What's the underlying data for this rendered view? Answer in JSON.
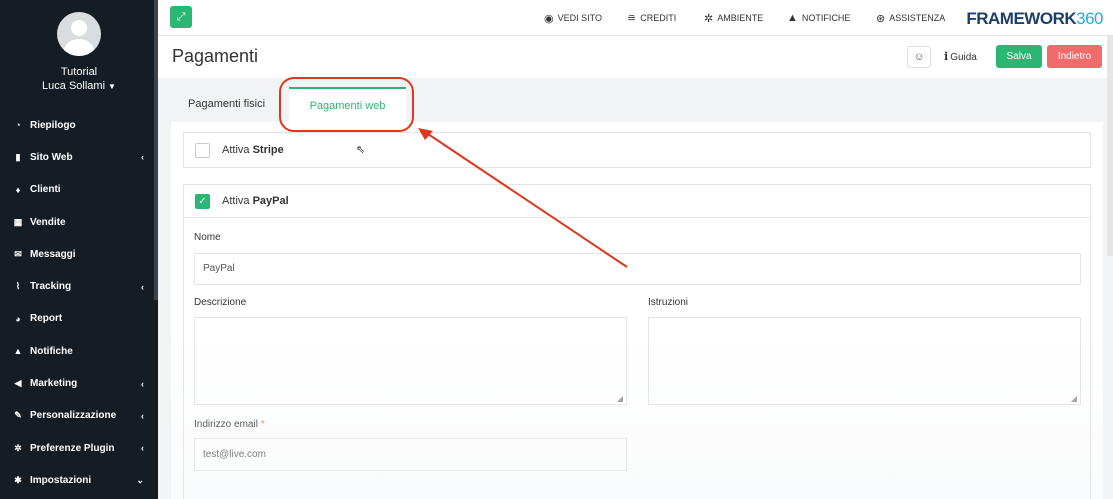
{
  "sidebar": {
    "user_line1": "Tutorial",
    "user_line2": "Luca Sollami",
    "items": [
      {
        "label": "Riepilogo",
        "icon": "dashboard-icon",
        "glyph": "◔",
        "chevron": ""
      },
      {
        "label": "Sito Web",
        "icon": "file-icon",
        "glyph": "▮",
        "chevron": "‹"
      },
      {
        "label": "Clienti",
        "icon": "person-icon",
        "glyph": "♦",
        "chevron": ""
      },
      {
        "label": "Vendite",
        "icon": "calculator-icon",
        "glyph": "▦",
        "chevron": ""
      },
      {
        "label": "Messaggi",
        "icon": "envelope-icon",
        "glyph": "✉",
        "chevron": ""
      },
      {
        "label": "Tracking",
        "icon": "chart-icon",
        "glyph": "⌇",
        "chevron": "‹"
      },
      {
        "label": "Report",
        "icon": "pie-icon",
        "glyph": "◕",
        "chevron": ""
      },
      {
        "label": "Notifiche",
        "icon": "bell-icon",
        "glyph": "▲",
        "chevron": ""
      },
      {
        "label": "Marketing",
        "icon": "megaphone-icon",
        "glyph": "◀",
        "chevron": "‹"
      },
      {
        "label": "Personalizzazione",
        "icon": "brush-icon",
        "glyph": "✎",
        "chevron": "‹"
      },
      {
        "label": "Preferenze Plugin",
        "icon": "cogs-icon",
        "glyph": "✲",
        "chevron": "‹"
      },
      {
        "label": "Impostazioni",
        "icon": "gear-icon",
        "glyph": "✱",
        "chevron": "⌄"
      }
    ]
  },
  "topbar": {
    "vedi_sito": "VEDI SITO",
    "crediti": "CREDITI",
    "ambiente": "AMBIENTE",
    "notifiche": "NOTIFICHE",
    "assistenza": "ASSISTENZA",
    "brand_text": "FRAMEWORK",
    "brand_num": "360"
  },
  "header": {
    "title": "Pagamenti",
    "smile": "☺",
    "guida_i": "i",
    "guida": "Guida",
    "salva": "Salva",
    "indietro": "Indietro"
  },
  "tabs": {
    "fisici": "Pagamenti fisici",
    "web": "Pagamenti web"
  },
  "stripe": {
    "prefix": "Attiva ",
    "name": "Stripe",
    "checked": false
  },
  "paypal": {
    "prefix": "Attiva ",
    "name": "PayPal",
    "checked": true,
    "nome_label": "Nome",
    "nome_value": "PayPal",
    "descrizione_label": "Descrizione",
    "istruzioni_label": "Istruzioni",
    "email_label": "Indirizzo email",
    "email_required": "*",
    "email_value": "test@live.com"
  },
  "colors": {
    "accent": "#2bb673",
    "danger": "#f26b6b",
    "sidebar_bg": "#141d23",
    "annotation": "#e0361c"
  }
}
